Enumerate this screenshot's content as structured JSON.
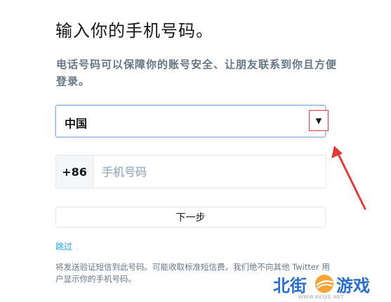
{
  "header": {
    "title": "输入你的手机号码。",
    "subtitle": "电话号码可以保障你的账号安全、让朋友联系到你且方便登录。"
  },
  "form": {
    "country": {
      "value": "中国",
      "dropdown_glyph": "▼"
    },
    "phone": {
      "country_code": "+86",
      "placeholder": "手机号码"
    },
    "next_label": "下一步",
    "skip_label": "跳过",
    "notice": "将发送验证短信到此号码。可能收取标准短信费。我们绝不向其他 Twitter 用户显示你的手机号码。"
  },
  "annotation": {
    "highlight_color": "#e03b3b"
  },
  "watermark": {
    "left_text": "北街",
    "right_text": "游戏",
    "url": "WWW.BEIJIE.NET",
    "logo_icon": "bj-logo-icon"
  }
}
